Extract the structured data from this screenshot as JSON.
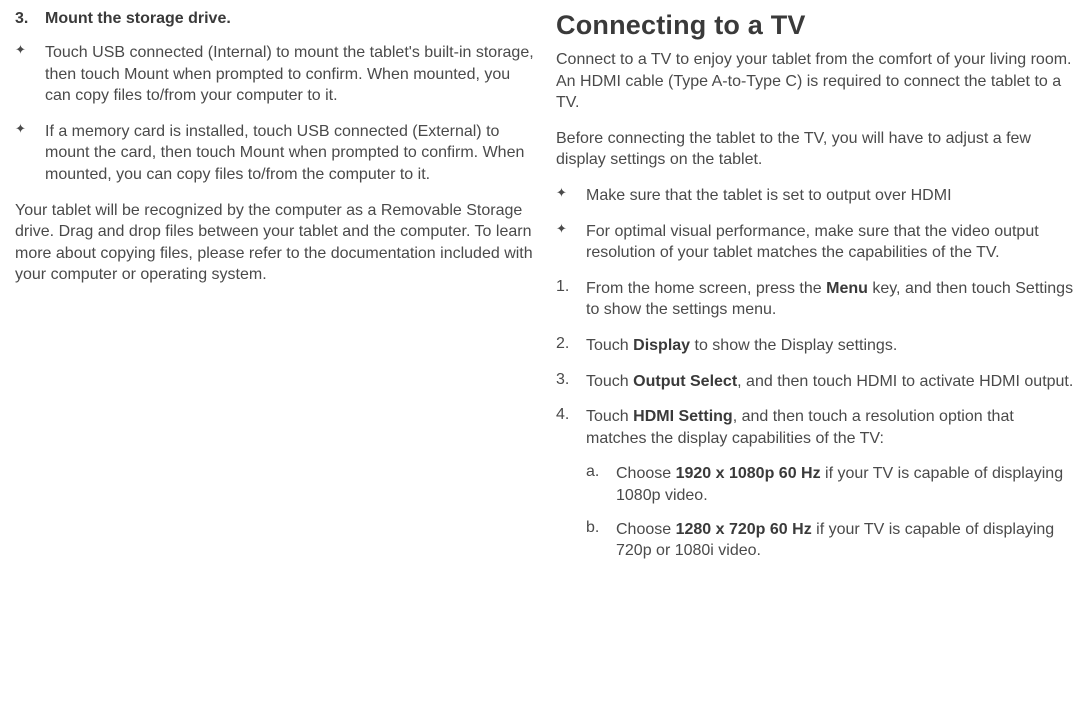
{
  "left": {
    "step3_num": "3.",
    "step3_title": "Mount the storage drive.",
    "bullets": [
      "Touch USB connected (Internal) to mount the tablet's built-in storage, then touch Mount when prompted to confirm. When mounted, you can copy files to/from your computer to it.",
      "If a memory card is installed, touch USB connected (External) to mount the card, then touch Mount when prompted to confirm. When mounted, you can copy files to/from the computer to it."
    ],
    "para": "Your tablet will be recognized by the computer as a Removable Storage drive. Drag and drop files between your tablet and the computer. To learn more about copying files, please refer to the documentation included with your computer or operating system."
  },
  "right": {
    "heading": "Connecting to a TV",
    "intro1": "Connect to a TV to enjoy your tablet from the comfort of your living room. An HDMI cable (Type A-to-Type C) is required to connect the tablet to a TV.",
    "intro2": "Before connecting the tablet to the TV, you will have to adjust a few display settings on the tablet.",
    "bullets": [
      "Make sure that the tablet is set to output over HDMI",
      "For optimal visual performance, make sure that the video output resolution of your tablet matches the capabilities of the TV."
    ],
    "steps": {
      "s1_num": "1.",
      "s1_a": "From the home screen, press the ",
      "s1_b": "Menu",
      "s1_c": " key, and then touch Settings to show the settings menu.",
      "s2_num": "2.",
      "s2_a": "Touch ",
      "s2_b": "Display",
      "s2_c": " to show the Display settings.",
      "s3_num": "3.",
      "s3_a": "Touch ",
      "s3_b": "Output Select",
      "s3_c": ", and then touch HDMI to activate HDMI output.",
      "s4_num": "4.",
      "s4_a": "Touch ",
      "s4_b": "HDMI Setting",
      "s4_c": ", and then touch a resolution option that matches the display capabilities of the TV:"
    },
    "sub": {
      "a_letter": "a.",
      "a_a": "Choose ",
      "a_b": "1920 x 1080p 60 Hz",
      "a_c": " if your TV is capable of displaying 1080p video.",
      "b_letter": "b.",
      "b_a": "Choose ",
      "b_b": "1280 x 720p 60 Hz",
      "b_c": " if your TV is capable of displaying 720p or 1080i video."
    }
  },
  "icons": {
    "star": "✦"
  }
}
